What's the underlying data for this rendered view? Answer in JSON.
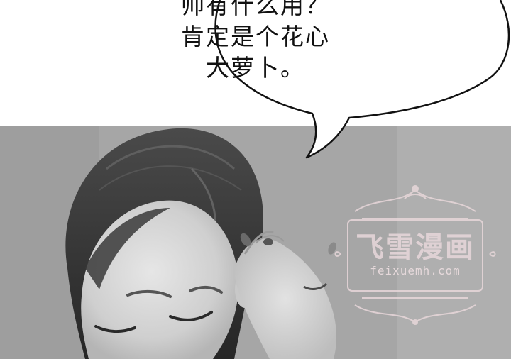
{
  "speech_bubble": {
    "lines": [
      "帅有什么用？",
      "肯定是个花心",
      "大萝卜。"
    ]
  },
  "watermark": {
    "title": "飞雪漫画",
    "url": "feixuemh.com"
  },
  "colors": {
    "background": "#ffffff",
    "ink": "#111111",
    "photo_tone": "#a8a8a8",
    "watermark_pink": "#e8d7da"
  }
}
